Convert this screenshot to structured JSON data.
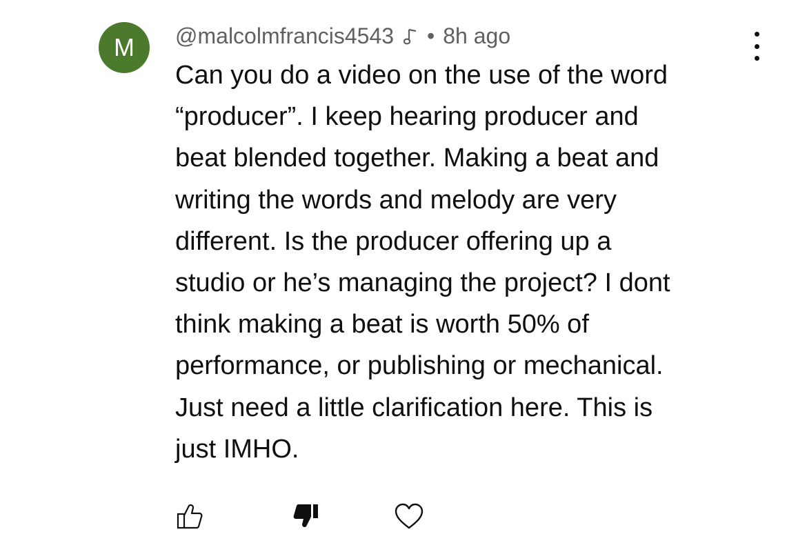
{
  "author": {
    "avatar_letter": "M",
    "avatar_color": "#4c7a2c",
    "handle": "@malcolmfrancis4543",
    "badge_icon": "music-note-icon",
    "separator": "•",
    "timestamp": "8h ago"
  },
  "comment": {
    "lines": [
      "Can you do a video on the use of the word",
      "“producer”. I keep hearing producer and",
      "beat blended together. Making a beat and",
      "writing the words and melody are very",
      "different. Is the producer offering up a",
      "studio or he’s managing the project? I dont",
      "think making a beat is worth 50% of",
      "performance, or publishing or mechanical.",
      "Just need a little clarification here. This is",
      "just IMHO."
    ]
  },
  "actions": {
    "like_icon": "thumbs-up-icon",
    "dislike_icon": "thumbs-down-filled-icon",
    "heart_icon": "heart-icon"
  },
  "menu_icon": "more-vertical-icon"
}
